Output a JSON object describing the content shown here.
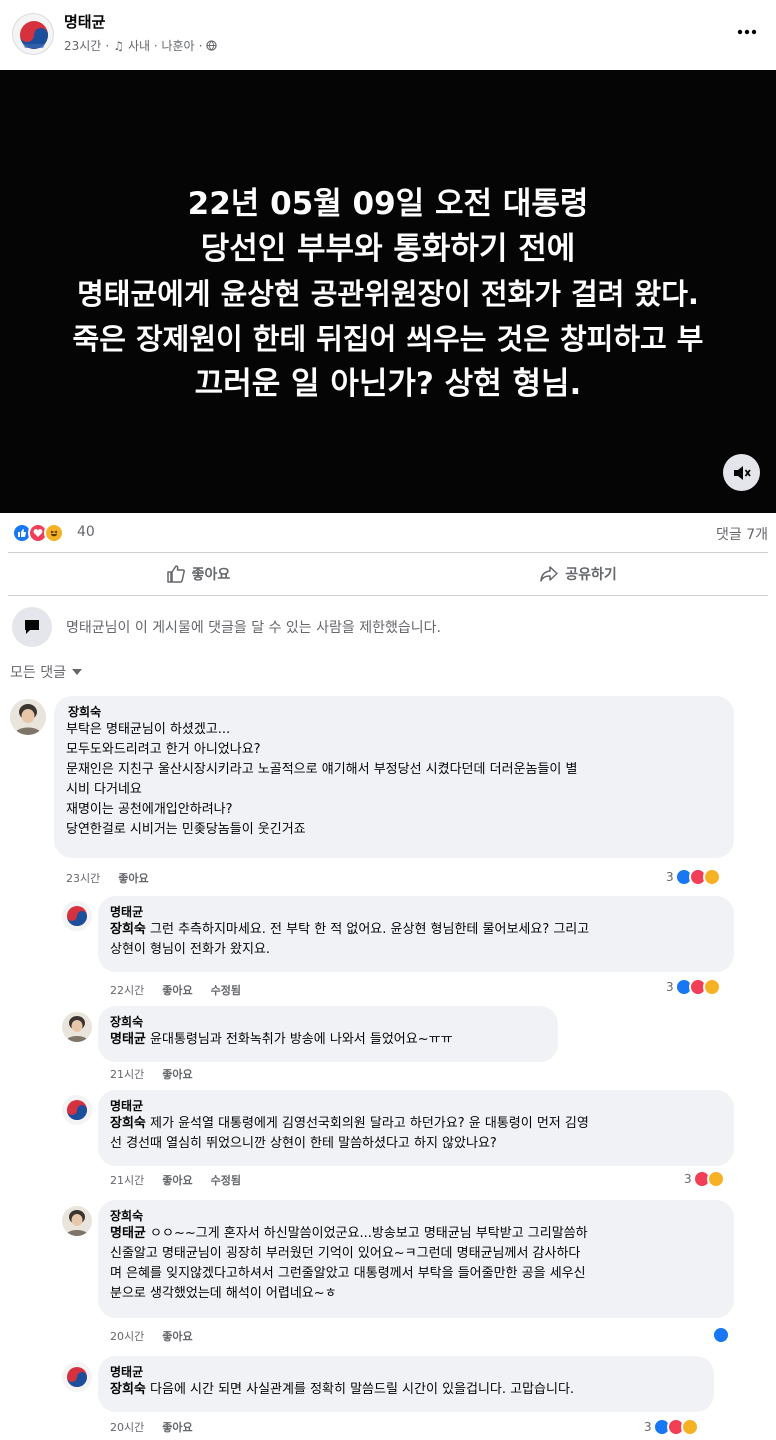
{
  "post": {
    "author": "명태균",
    "time": "23시간",
    "audience": "사내 · 나훈아",
    "video_lines": [
      "22년 05월 09일 오전 대통령",
      "당선인 부부와 통화하기 전에",
      "명태균에게 윤상현 공관위원장이 전화가 걸려 왔다.",
      "죽은 장제원이 한테 뒤집어 씌우는 것은 창피하고 부",
      "끄러운 일 아닌가? 상현 형님."
    ],
    "reaction_count": "40",
    "comment_count": "댓글 7개",
    "like_label": "좋아요",
    "share_label": "공유하기",
    "notice": "명태균님이 이 게시물에 댓글을 달 수 있는 사람을 제한했습니다.",
    "sort_label": "모든 댓글"
  },
  "comments": [
    {
      "name": "장희숙",
      "text": "부탁은 명태균님이 하셨겠고...\n모두도와드리려고 한거 아니었나요?\n문재인은 지친구 울산시장시키라고 노골적으로 얘기해서 부정당선 시켰다던데 더러운놈들이 별\n시비 다거네요\n재명이는 공천에개입안하려나?\n당연한걸로 시비거는 민좆당놈들이 웃긴거죠",
      "time": "23시간",
      "like": "좋아요",
      "reaction_count": "3"
    },
    {
      "name": "명태균",
      "mention": "장희숙",
      "text": " 그런 추측하지마세요. 전 부탁 한 적 없어요. 윤상현 형님한테 물어보세요? 그리고\n상현이 형님이 전화가 왔지요.",
      "time": "22시간",
      "like": "좋아요",
      "edited": "수정됨",
      "reaction_count": "3"
    },
    {
      "name": "장희숙",
      "mention": "명태균",
      "text": " 윤대통령님과 전화녹취가 방송에 나와서 들었어요~ㅠㅠ",
      "time": "21시간",
      "like": "좋아요"
    },
    {
      "name": "명태균",
      "mention": "장희숙",
      "text": " 제가 윤석열 대통령에게 김영선국회의원 달라고 하던가요? 윤 대통령이 먼저 김영\n선 경선때 열심히 뛰었으니깐 상현이 한테 말씀하셨다고 하지 않았나요?",
      "time": "21시간",
      "like": "좋아요",
      "edited": "수정됨",
      "reaction_count": "3"
    },
    {
      "name": "장희숙",
      "mention": "명태균",
      "text": " ㅇㅇ~~그게 혼자서 하신말씀이었군요...방송보고 명태균님 부탁받고 그리말씀하\n신줄알고 명태균님이 굉장히 부러웠던 기억이 있어요~ㅋ그런데 명태균님께서 감사하다\n며 은혜를 잊지않겠다고하셔서 그런줄알았고 대통령께서 부탁을 들어줄만한 공을 세우신\n분으로 생각했었는데 해석이 어렵네요~ㅎ",
      "time": "20시간",
      "like": "좋아요"
    },
    {
      "name": "명태균",
      "mention": "장희숙",
      "text": " 다음에 시간 되면 사실관계를 정확히 말씀드릴 시간이 있을겁니다. 고맙습니다.",
      "time": "20시간",
      "like": "좋아요",
      "reaction_count": "3"
    }
  ],
  "colors": {
    "like_blue": "#1877f2",
    "love_red": "#f33e58",
    "haha_yellow": "#f7b125",
    "bubble_bg": "#f0f2f5",
    "secondary_text": "#65676b"
  }
}
